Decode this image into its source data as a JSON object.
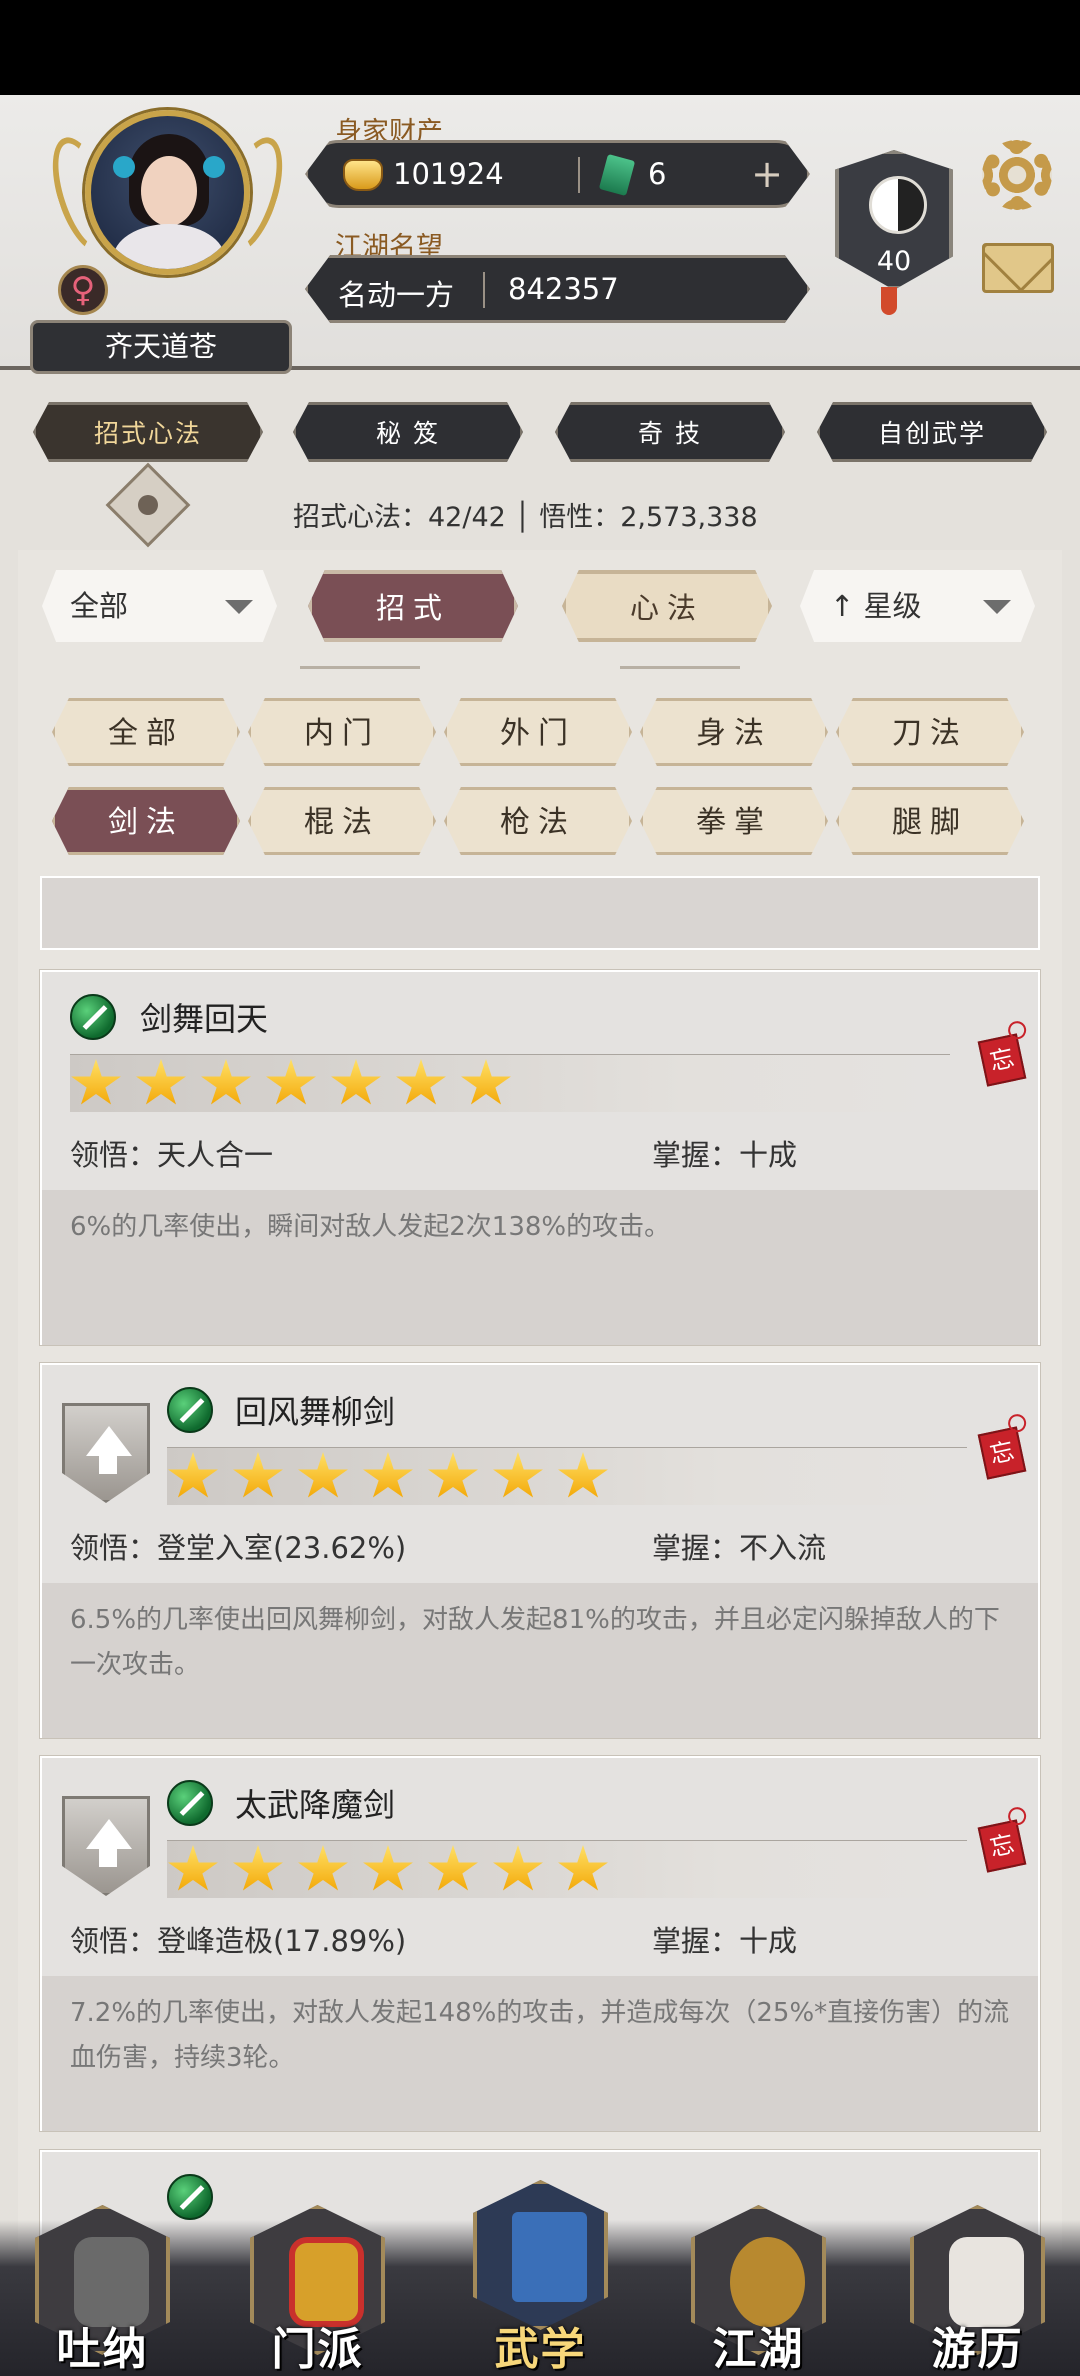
{
  "header": {
    "player_name": "齐天道苍",
    "gender_symbol": "♀",
    "wealth_label": "身家财产",
    "gold_amount": "101924",
    "jade_amount": "6",
    "plus_symbol": "+",
    "reputation_label": "江湖名望",
    "reputation_title": "名动一方",
    "reputation_value": "842357",
    "level": "40"
  },
  "top_tabs": [
    {
      "label": "招式心法",
      "active": true
    },
    {
      "label": "秘 笈",
      "active": false
    },
    {
      "label": "奇 技",
      "active": false
    },
    {
      "label": "自创武学",
      "active": false
    }
  ],
  "stats": {
    "line": "招式心法：42/42 │ 悟性：2,573,338"
  },
  "filters": {
    "scope_dropdown": "全部",
    "type_buttons": [
      {
        "label": "招式",
        "active": true
      },
      {
        "label": "心法",
        "active": false
      }
    ],
    "sort_dropdown": "星级",
    "sort_arrow": "↑",
    "categories_row1": [
      "全部",
      "内门",
      "外门",
      "身法",
      "刀法"
    ],
    "categories_row2": [
      "剑法",
      "棍法",
      "枪法",
      "拳掌",
      "腿脚"
    ],
    "active_category": "剑法"
  },
  "skills": [
    {
      "name": "剑舞回天",
      "stars": 7,
      "comprehension_label": "领悟：",
      "comprehension": "天人合一",
      "mastery_label": "掌握：",
      "mastery": "十成",
      "description": "6%的几率使出，瞬间对敌人发起2次138%的攻击。",
      "upgradable": false,
      "forget_tag": "忘"
    },
    {
      "name": "回风舞柳剑",
      "stars": 7,
      "comprehension_label": "领悟：",
      "comprehension": "登堂入室(23.62%)",
      "mastery_label": "掌握：",
      "mastery": "不入流",
      "description": "6.5%的几率使出回风舞柳剑，对敌人发起81%的攻击，并且必定闪躲掉敌人的下一次攻击。",
      "upgradable": true,
      "forget_tag": "忘"
    },
    {
      "name": "太武降魔剑",
      "stars": 7,
      "comprehension_label": "领悟：",
      "comprehension": "登峰造极(17.89%)",
      "mastery_label": "掌握：",
      "mastery": "十成",
      "description": "7.2%的几率使出，对敌人发起148%的攻击，并造成每次（25%*直接伤害）的流血伤害，持续3轮。",
      "upgradable": true,
      "forget_tag": "忘"
    }
  ],
  "bottom_nav": [
    {
      "label": "吐纳",
      "icon": "meditation-figure-icon",
      "color": "#555"
    },
    {
      "label": "门派",
      "icon": "sect-banner-icon",
      "color": "#c9302c"
    },
    {
      "label": "武学",
      "icon": "scroll-book-icon",
      "color": "#3a6fb8",
      "active": true
    },
    {
      "label": "江湖",
      "icon": "straw-hat-icon",
      "color": "#b8892f"
    },
    {
      "label": "游历",
      "icon": "white-horse-icon",
      "color": "#e8e4df"
    }
  ],
  "colors": {
    "active_tab": "#7a4f55",
    "idle_tab": "#e9dcc4",
    "gold_label": "#8a5a22",
    "forget_tag": "#c8222a",
    "star": "#f2a400"
  }
}
